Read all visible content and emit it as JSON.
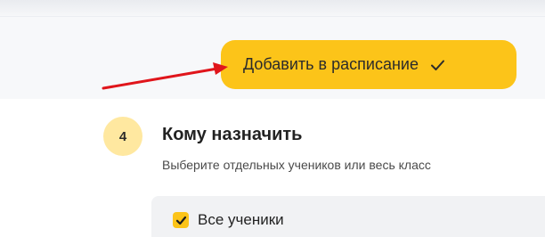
{
  "header": {
    "add_button_label": "Добавить в расписание"
  },
  "step": {
    "number": "4",
    "title": "Кому назначить",
    "description": "Выберите отдельных учеников или весь класс"
  },
  "students": {
    "all_label": "Все ученики",
    "all_checked": true
  },
  "colors": {
    "accent": "#fcc419",
    "step_circle": "#ffe8a0",
    "annotation_arrow": "#e0151b"
  }
}
